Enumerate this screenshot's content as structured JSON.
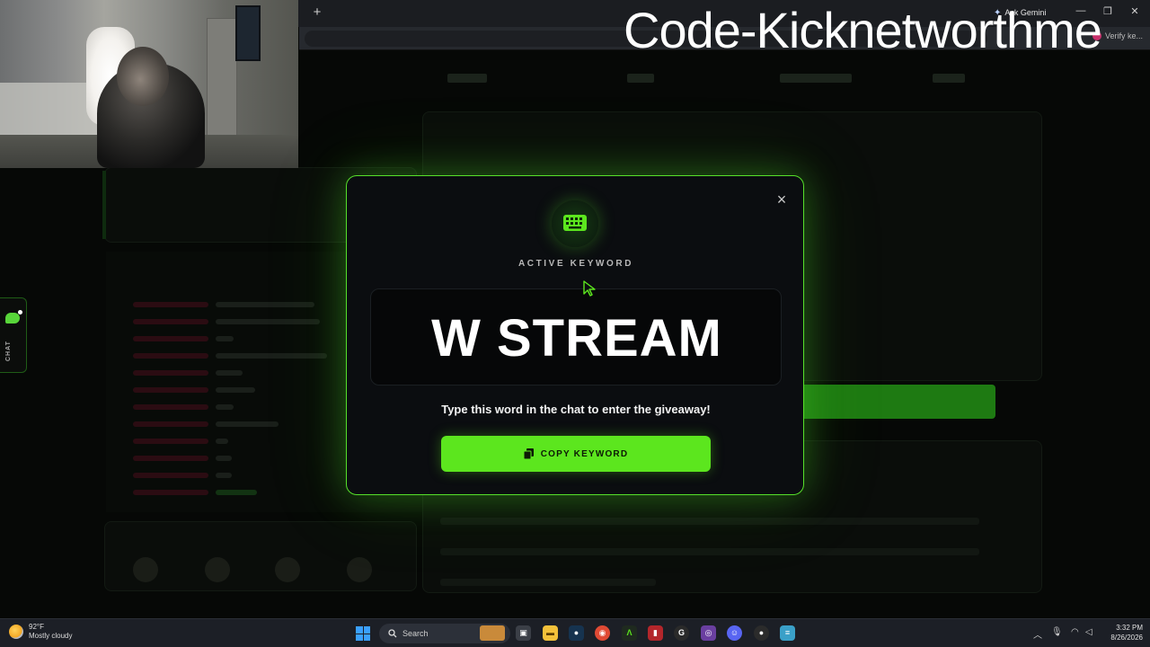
{
  "overlay": {
    "text": "Code-Kicknetworthme"
  },
  "browser": {
    "new_tab": "+",
    "gemini_label": "Ask Gemini",
    "profile_label": "Verify ke..."
  },
  "modal": {
    "close_symbol": "×",
    "active_label": "ACTIVE KEYWORD",
    "keyword": "W STREAM",
    "instruction": "Type this word in the chat to enter the giveaway!",
    "copy_label": "COPY KEYWORD",
    "accent_color": "#5ce61e"
  },
  "chat_tab": {
    "label": "CHAT"
  },
  "taskbar": {
    "weather_temp": "92°F",
    "weather_desc": "Mostly cloudy",
    "search_placeholder": "Search",
    "time": "3:32 PM",
    "date": "8/26/2026"
  },
  "icons": {
    "keyboard": "keyboard-icon",
    "copy": "copy-icon",
    "close": "close-icon",
    "chat": "chat-bubble-icon"
  }
}
